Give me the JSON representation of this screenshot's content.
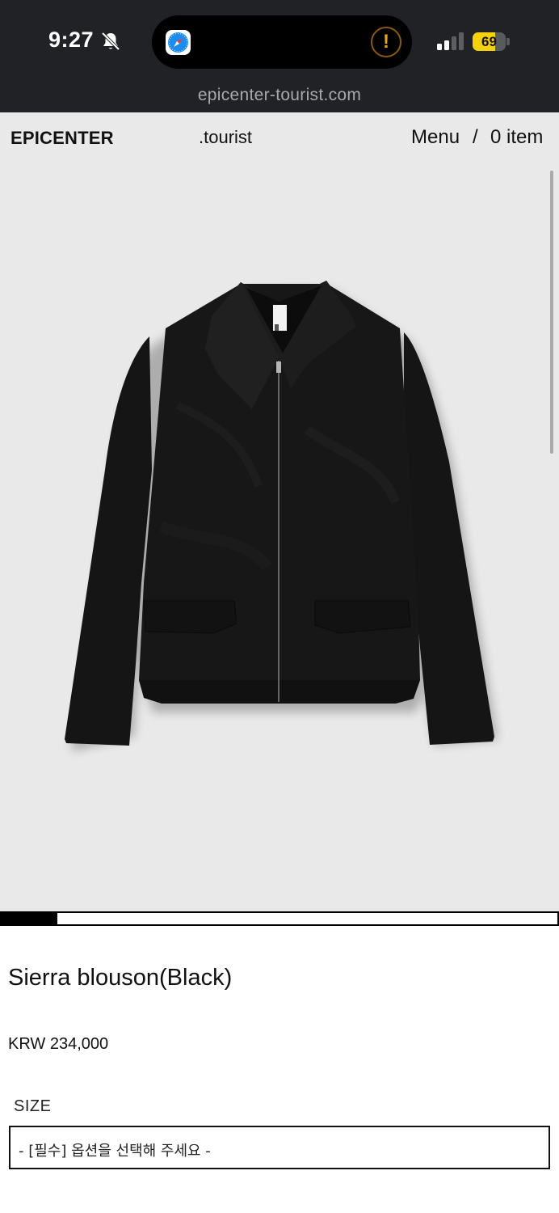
{
  "status_bar": {
    "time": "9:27",
    "battery_level": "69",
    "battery_fraction": 0.69,
    "alert_glyph": "!",
    "icons": [
      "bell-muted-icon",
      "safari-icon",
      "alert-icon",
      "signal-icon",
      "battery-icon"
    ],
    "battery_color": "#f5d10a"
  },
  "browser": {
    "url": "epicenter-tourist.com"
  },
  "header": {
    "brand": "EPICENTER",
    "sub_brand": ".tourist",
    "menu_label": "Menu",
    "separator": "/",
    "cart_label": "0 item"
  },
  "product": {
    "image_subject": "black suede zip jacket",
    "image_background": "#e9e9e9",
    "gallery_progress": 0.1,
    "name": "Sierra blouson(Black)",
    "price": "KRW 234,000",
    "option_label": "SIZE",
    "option_placeholder": "- [필수] 옵션을 선택해 주세요 -"
  }
}
